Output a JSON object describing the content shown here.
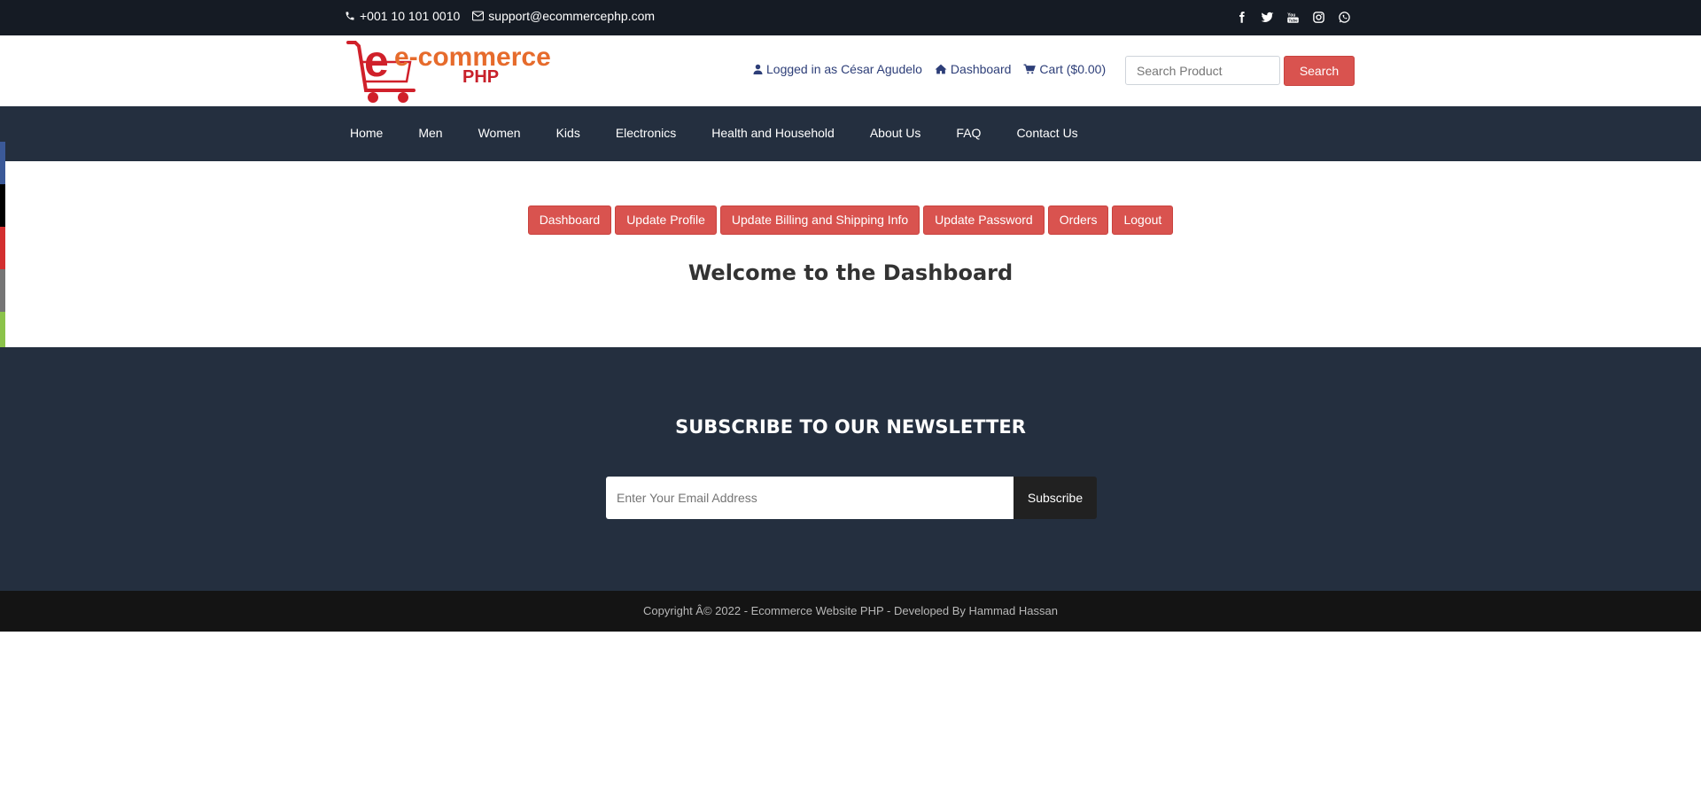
{
  "topbar": {
    "phone": "+001 10 101 0010",
    "email": "support@ecommercephp.com",
    "social_icons": [
      "facebook-icon",
      "twitter-icon",
      "youtube-icon",
      "instagram-icon",
      "whatsapp-icon"
    ]
  },
  "header": {
    "logo_text_main": "e-commerce",
    "logo_text_sub": "PHP",
    "logged_in_label": "Logged in as César Agudelo",
    "dashboard_label": "Dashboard",
    "cart_label": "Cart ($0.00)",
    "search_placeholder": "Search Product",
    "search_button": "Search"
  },
  "nav": {
    "items": [
      "Home",
      "Men",
      "Women",
      "Kids",
      "Electronics",
      "Health and Household",
      "About Us",
      "FAQ",
      "Contact Us"
    ]
  },
  "side_strip": {
    "colors": [
      "#3b5998",
      "#000000",
      "#d32f2f",
      "#757575",
      "#8bc34a"
    ]
  },
  "main": {
    "buttons": [
      "Dashboard",
      "Update Profile",
      "Update Billing and Shipping Info",
      "Update Password",
      "Orders",
      "Logout"
    ],
    "welcome": "Welcome to the Dashboard"
  },
  "newsletter": {
    "title": "SUBSCRIBE TO OUR NEWSLETTER",
    "input_placeholder": "Enter Your Email Address",
    "button": "Subscribe"
  },
  "footer": {
    "copyright": "Copyright Â© 2022 - Ecommerce Website PHP - Developed By Hammad Hassan"
  },
  "colors": {
    "topbar_bg": "#151b24",
    "nav_bg": "#242f3f",
    "accent_red": "#d9534f",
    "footer_bg": "#141414"
  }
}
